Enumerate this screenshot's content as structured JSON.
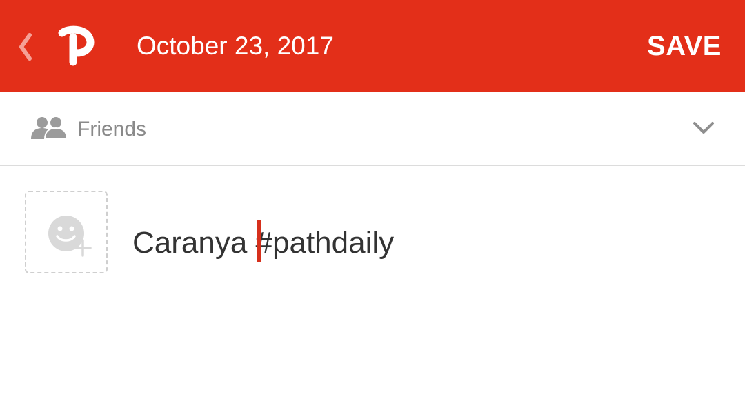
{
  "header": {
    "back_icon": "chevron-left-icon",
    "logo_icon": "path-logo-icon",
    "date": "October 23, 2017",
    "save_label": "SAVE",
    "background_color": "#e32f19"
  },
  "audience": {
    "icon": "friends-icon",
    "label": "Friends",
    "dropdown_icon": "chevron-down-icon"
  },
  "composer": {
    "sticker_icon": "add-sticker-icon",
    "text_before_caret": "Caranya ",
    "text_after_caret": "#pathdaily",
    "caret_color": "#d6301c"
  }
}
